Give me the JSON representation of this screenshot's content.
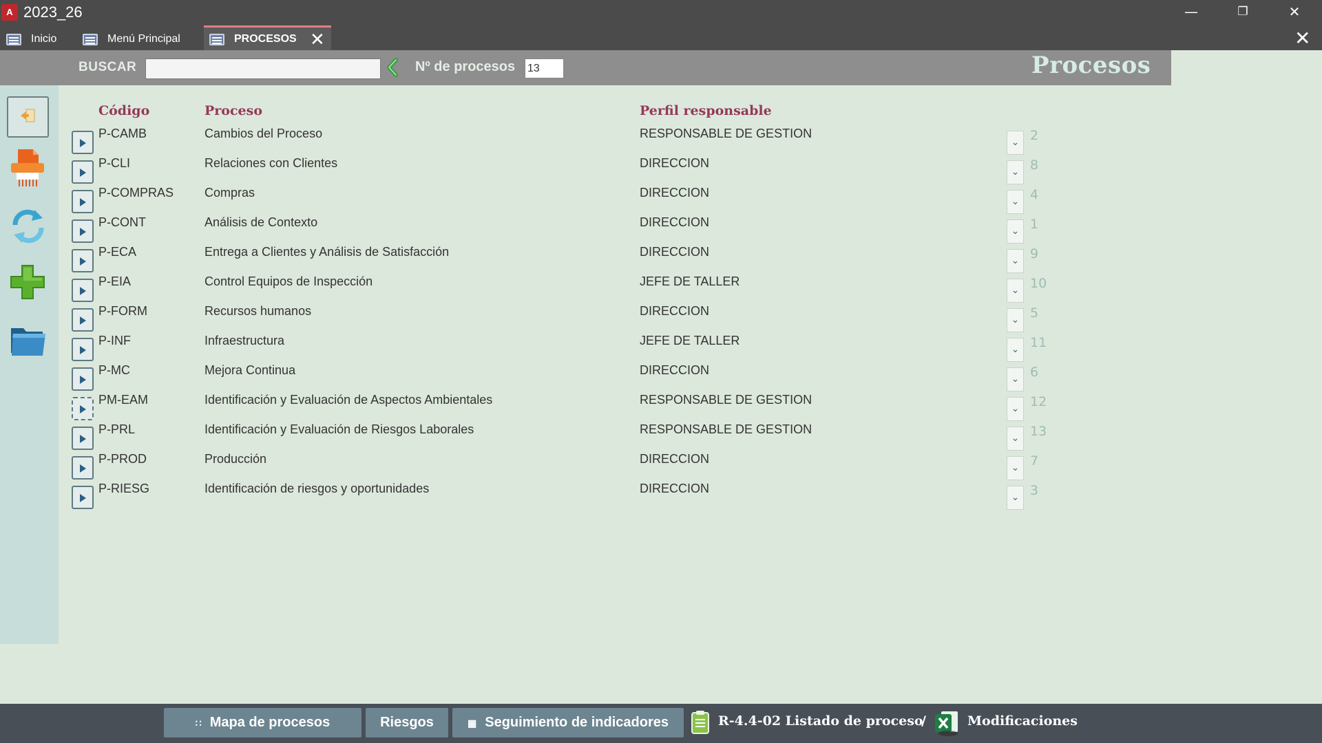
{
  "window": {
    "app_icon_letter": "A",
    "title": "2023_26"
  },
  "tabs": [
    {
      "label": "Inicio"
    },
    {
      "label": "Menú Principal"
    },
    {
      "label": "PROCESOS"
    }
  ],
  "header": {
    "search_label": "BUSCAR",
    "search_value": "",
    "count_label": "Nº de procesos",
    "count_value": "13",
    "title": "Procesos"
  },
  "columns": {
    "code": "Código",
    "process": "Proceso",
    "profile": "Perfil responsable"
  },
  "rows": [
    {
      "code": "P-CAMB",
      "process": "Cambios del Proceso",
      "profile": "RESPONSABLE DE GESTION",
      "num": "2"
    },
    {
      "code": "P-CLI",
      "process": "Relaciones con Clientes",
      "profile": "DIRECCION",
      "num": "8"
    },
    {
      "code": "P-COMPRAS",
      "process": "Compras",
      "profile": "DIRECCION",
      "num": "4"
    },
    {
      "code": "P-CONT",
      "process": "Análisis de Contexto",
      "profile": "DIRECCION",
      "num": "1"
    },
    {
      "code": "P-ECA",
      "process": "Entrega a Clientes y Análisis de Satisfacción",
      "profile": "DIRECCION",
      "num": "9"
    },
    {
      "code": "P-EIA",
      "process": "Control Equipos de Inspección",
      "profile": "JEFE DE TALLER",
      "num": "10"
    },
    {
      "code": "P-FORM",
      "process": "Recursos humanos",
      "profile": "DIRECCION",
      "num": "5"
    },
    {
      "code": "P-INF",
      "process": "Infraestructura",
      "profile": "JEFE DE TALLER",
      "num": "11"
    },
    {
      "code": "P-MC",
      "process": "Mejora Continua",
      "profile": "DIRECCION",
      "num": "6"
    },
    {
      "code": "PM-EAM",
      "process": "Identificación y Evaluación de Aspectos Ambientales",
      "profile": "RESPONSABLE DE GESTION",
      "num": "12"
    },
    {
      "code": "P-PRL",
      "process": "Identificación y Evaluación de Riesgos Laborales",
      "profile": "RESPONSABLE DE GESTION",
      "num": "13"
    },
    {
      "code": "P-PROD",
      "process": "Producción",
      "profile": "DIRECCION",
      "num": "7"
    },
    {
      "code": "P-RIESG",
      "process": "Identificación de riesgos y oportunidades",
      "profile": "DIRECCION",
      "num": "3"
    }
  ],
  "footer": {
    "btn_mapa": "Mapa de procesos",
    "btn_riesgos": "Riesgos",
    "btn_seguimiento": "Seguimiento de indicadores",
    "link_listado": "R-4.4-02 Listado de proceso",
    "separator": "/",
    "link_modificaciones": "Modificaciones"
  },
  "icons": {
    "sidebar": [
      "back-exit-icon",
      "pdf-document-icon",
      "refresh-icon",
      "add-icon",
      "folder-icon"
    ],
    "footer": [
      "map-dots-icon",
      "grid-icon",
      "clipboard-icon",
      "excel-icon"
    ]
  },
  "colors": {
    "accent_header_text": "#93395a",
    "active_tab_border": "#e27f84",
    "sidebar_bg": "#c7ddd9",
    "content_bg": "#dde8dc"
  }
}
